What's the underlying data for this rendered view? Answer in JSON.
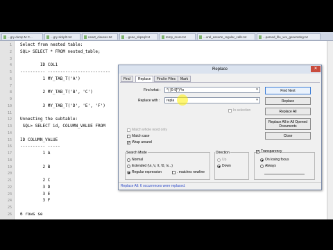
{
  "tabs": [
    {
      "label": "...gry dump M C..."
    },
    {
      "label": "...gry skripl2.txt"
    },
    {
      "label": "new3_clauses.txt"
    },
    {
      "label": "...gene_skpsql.txt"
    },
    {
      "label": "temp_more.txt"
    },
    {
      "label": "...oral_assorte_regular_calls.txt"
    },
    {
      "label": "...parsed_file_xxx_generating.txt"
    }
  ],
  "editor": {
    "lines": [
      {
        "n": "1",
        "text": "Select from nested table:"
      },
      {
        "n": "2",
        "text": "SQL> SELECT * FROM nested_table;"
      },
      {
        "n": "3",
        "text": ""
      },
      {
        "n": "4",
        "text": "        ID COL1"
      },
      {
        "n": "5",
        "text": "---------- -------------------------"
      },
      {
        "n": "6",
        "text": "         1 MY_TAB_T('A')"
      },
      {
        "n": "7",
        "text": ""
      },
      {
        "n": "8",
        "text": "         2 MY_TAB_T('B', 'C')"
      },
      {
        "n": "9",
        "text": ""
      },
      {
        "n": "10",
        "text": "         3 MY_TAB_T('D', 'E', 'F')"
      },
      {
        "n": "11",
        "text": ""
      },
      {
        "n": "12",
        "text": "Unnesting the subtable:"
      },
      {
        "n": "13",
        "text": " SQL> SELECT id, COLUMN_VALUE FROM"
      },
      {
        "n": "14",
        "text": ""
      },
      {
        "n": "15",
        "text": "ID COLUMN_VALUE"
      },
      {
        "n": "16",
        "text": "---------- -----"
      },
      {
        "n": "17",
        "text": "         1 A"
      },
      {
        "n": "18",
        "text": ""
      },
      {
        "n": "19",
        "text": "         2 B"
      },
      {
        "n": "20",
        "text": ""
      },
      {
        "n": "21",
        "text": "         2 C"
      },
      {
        "n": "22",
        "text": "         3 D"
      },
      {
        "n": "23",
        "text": "         3 E"
      },
      {
        "n": "24",
        "text": "         3 F"
      },
      {
        "n": "25",
        "text": ""
      },
      {
        "n": "26",
        "text": "6 rows se"
      }
    ]
  },
  "dialog": {
    "title": "Replace",
    "close": "✕",
    "tabs": [
      "Find",
      "Replace",
      "Find in Files",
      "Mark"
    ],
    "find_label": "Find what :",
    "find_value": "^( [0-9]*)*\\n",
    "replace_label": "Replace with :",
    "replace_value": "repla",
    "in_selection": "In selection",
    "buttons": {
      "find_next": "Find Next",
      "replace": "Replace",
      "replace_all": "Replace All",
      "replace_all_opened": "Replace All in All Opened Documents",
      "close": "Close"
    },
    "options": {
      "whole_word": "Match whole word only",
      "match_case": "Match case",
      "wrap_around": "Wrap around"
    },
    "search_mode": {
      "title": "Search Mode",
      "normal": "Normal",
      "extended": "Extended (\\n, \\r, \\t, \\0, \\x...)",
      "regex": "Regular expression",
      "matches_newline": ". matches newline"
    },
    "direction": {
      "title": "Direction",
      "up": "Up",
      "down": "Down"
    },
    "transparency": {
      "title": "Transparency",
      "on_losing_focus": "On losing focus",
      "always": "Always"
    },
    "status": "Replace All: 6 occurrences were replaced."
  }
}
